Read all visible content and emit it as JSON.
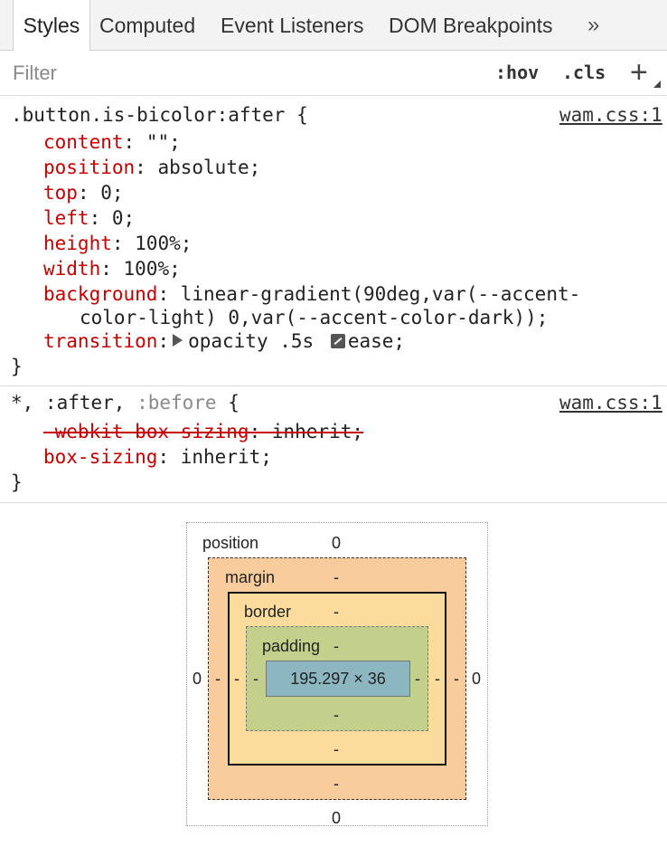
{
  "tabs": [
    {
      "label": "Styles",
      "active": true
    },
    {
      "label": "Computed",
      "active": false
    },
    {
      "label": "Event Listeners",
      "active": false
    },
    {
      "label": "DOM Breakpoints",
      "active": false
    }
  ],
  "tab_more_glyph": "»",
  "filter": {
    "placeholder": "Filter",
    "hov_label": ":hov",
    "cls_label": ".cls",
    "add_glyph": "+"
  },
  "rules": [
    {
      "selector": ".button.is-bicolor:after {",
      "source": "wam.css:1",
      "declarations": [
        {
          "name": "content",
          "value": " \"\";"
        },
        {
          "name": "position",
          "value": " absolute;"
        },
        {
          "name": "top",
          "value": " 0;"
        },
        {
          "name": "left",
          "value": " 0;"
        },
        {
          "name": "height",
          "value": " 100%;"
        },
        {
          "name": "width",
          "value": " 100%;"
        },
        {
          "name": "background",
          "value": " linear-gradient(90deg,var(--accent-",
          "continuation": "color-light) 0,var(--accent-color-dark));"
        },
        {
          "name": "transition",
          "value": "opacity .5s ",
          "value2": "ease;"
        }
      ],
      "close": "}"
    },
    {
      "selector_parts": [
        "*, :after, ",
        ":before",
        " {"
      ],
      "source": "wam.css:1",
      "declarations": [
        {
          "name": "-webkit-box-sizing",
          "value": ": inherit;",
          "overridden": true
        },
        {
          "name": "box-sizing",
          "value": " inherit;"
        }
      ],
      "close": "}"
    }
  ],
  "box_model": {
    "position_label": "position",
    "position": {
      "top": "0",
      "right": "0",
      "bottom": "0",
      "left": "0"
    },
    "margin_label": "margin",
    "margin": {
      "top": "-",
      "right": "-",
      "bottom": "-",
      "left": "-"
    },
    "border_label": "border",
    "border": {
      "top": "-",
      "right": "-",
      "bottom": "-",
      "left": "-"
    },
    "padding_label": "padding",
    "padding": {
      "top": "-",
      "right": "-",
      "bottom": "-",
      "left": "-"
    },
    "content": "195.297 × 36"
  }
}
